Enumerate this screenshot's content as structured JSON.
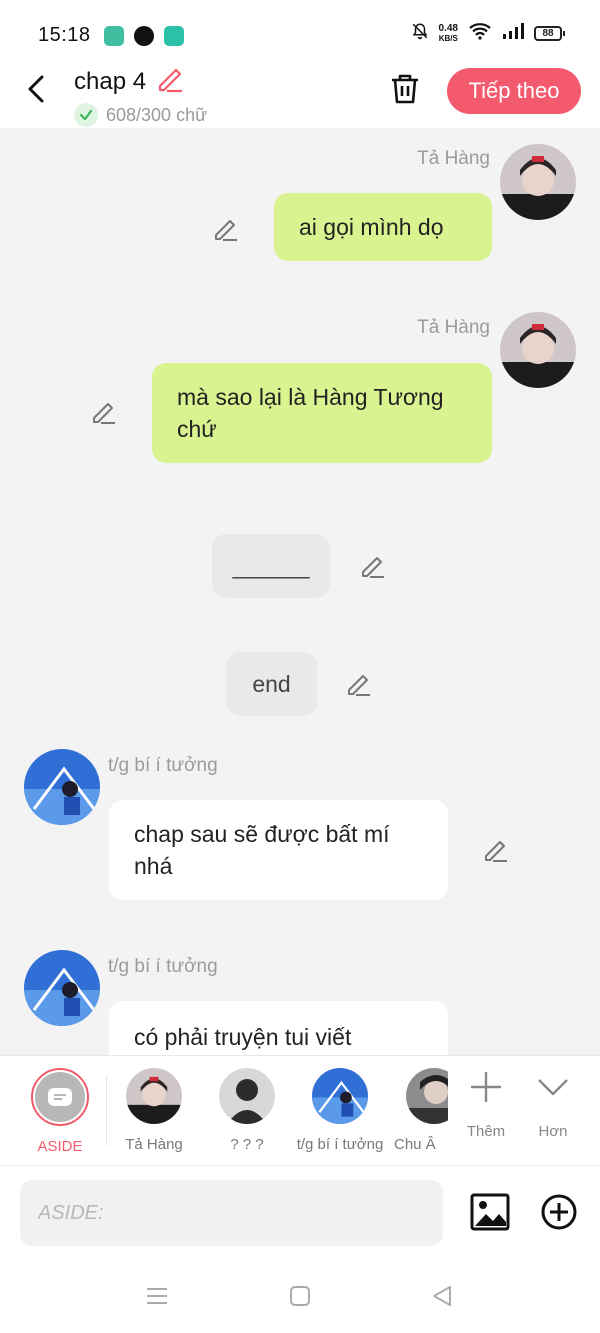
{
  "status_bar": {
    "time": "15:18",
    "speed_value": "0.48",
    "speed_unit": "KB/S",
    "battery": "88",
    "app_icon_colors": [
      "#3fbfa0",
      "#111111",
      "#2bc0a8"
    ]
  },
  "header": {
    "title": "chap 4",
    "word_count": "608/300 chữ",
    "next_label": "Tiếp theo",
    "accent_color": "#f45a6e"
  },
  "messages": [
    {
      "side": "right",
      "sender": "Tả Hàng",
      "text": "ai gọi mình dọ",
      "style": "green"
    },
    {
      "side": "right",
      "sender": "Tả Hàng",
      "text": "mà sao lại là Hàng Tương chứ",
      "style": "green"
    },
    {
      "side": "center",
      "text": "______",
      "style": "gray"
    },
    {
      "side": "center",
      "text": "end",
      "style": "gray"
    },
    {
      "side": "left",
      "sender": "t/g bí í tưởng",
      "text": "chap sau sẽ được bất mí nhá",
      "style": "white"
    },
    {
      "side": "left",
      "sender": "t/g bí í tưởng",
      "text": "có phải truyện tui viết",
      "style": "white"
    }
  ],
  "characters": [
    {
      "name": "ASIDE",
      "active": true
    },
    {
      "name": "Tả Hàng",
      "active": false
    },
    {
      "name": "? ? ?",
      "active": false
    },
    {
      "name": "t/g bí í tưởng",
      "active": false
    },
    {
      "name": "Chu Â",
      "active": false
    }
  ],
  "tools": {
    "add_label": "Thêm",
    "more_label": "Hơn"
  },
  "composer": {
    "placeholder": "ASIDE:"
  }
}
